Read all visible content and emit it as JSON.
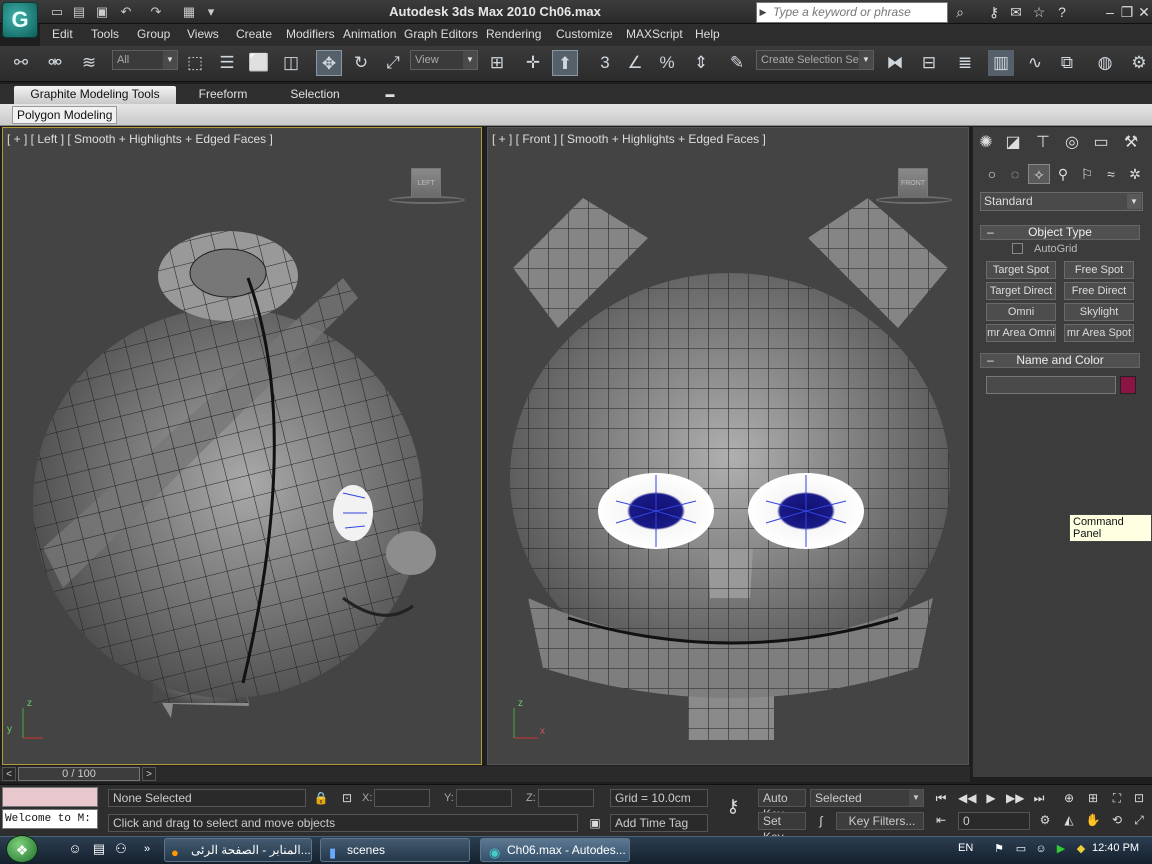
{
  "window": {
    "title": "Autodesk 3ds Max  2010     Ch06.max",
    "logo_glyph": "G"
  },
  "search": {
    "placeholder": "Type a keyword or phrase"
  },
  "menu": [
    "Edit",
    "Tools",
    "Group",
    "Views",
    "Create",
    "Modifiers",
    "Animation",
    "Graph Editors",
    "Rendering",
    "Customize",
    "MAXScript",
    "Help"
  ],
  "toolbar": {
    "selection_filter": "All",
    "ref_coord": "View",
    "named_selection": "Create Selection Se",
    "snap_label": "3"
  },
  "ribbon": {
    "tabs": [
      "Graphite Modeling Tools",
      "Freeform",
      "Selection"
    ],
    "sub_label": "Polygon Modeling"
  },
  "viewports": {
    "left": {
      "label": "[ + ] [ Left ] [ Smooth + Highlights + Edged Faces ]",
      "cube": "LEFT",
      "axis_x": "y",
      "axis_z": "z"
    },
    "front": {
      "label": "[ + ] [ Front ] [ Smooth + Highlights + Edged Faces ]",
      "cube": "FRONT",
      "axis_x": "x",
      "axis_z": "z"
    }
  },
  "command_panel": {
    "category": "Standard",
    "object_type_title": "Object Type",
    "autogrid_label": "AutoGrid",
    "buttons": [
      "Target Spot",
      "Free Spot",
      "Target Direct",
      "Free Direct",
      "Omni",
      "Skylight",
      "mr Area Omni",
      "mr Area Spot"
    ],
    "name_color_title": "Name and Color",
    "swatch_color": "#8a1444",
    "tooltip": "Command Panel"
  },
  "timeline": {
    "frame": "0 / 100"
  },
  "status": {
    "selection": "None Selected",
    "prompt": "Click and drag to select and move objects",
    "x_label": "X:",
    "y_label": "Y:",
    "z_label": "Z:",
    "grid": "Grid = 10.0cm",
    "add_time_tag": "Add Time Tag",
    "auto_key": "Auto Key",
    "set_key": "Set Key",
    "key_mode": "Selected",
    "key_filters": "Key Filters...",
    "current_frame": "0",
    "listener": "Welcome to M:"
  },
  "taskbar": {
    "tasks": [
      "المنابر - الصفحة الرئی...",
      "scenes",
      "Ch06.max - Autodes..."
    ],
    "lang": "EN",
    "clock": "12:40 PM"
  }
}
